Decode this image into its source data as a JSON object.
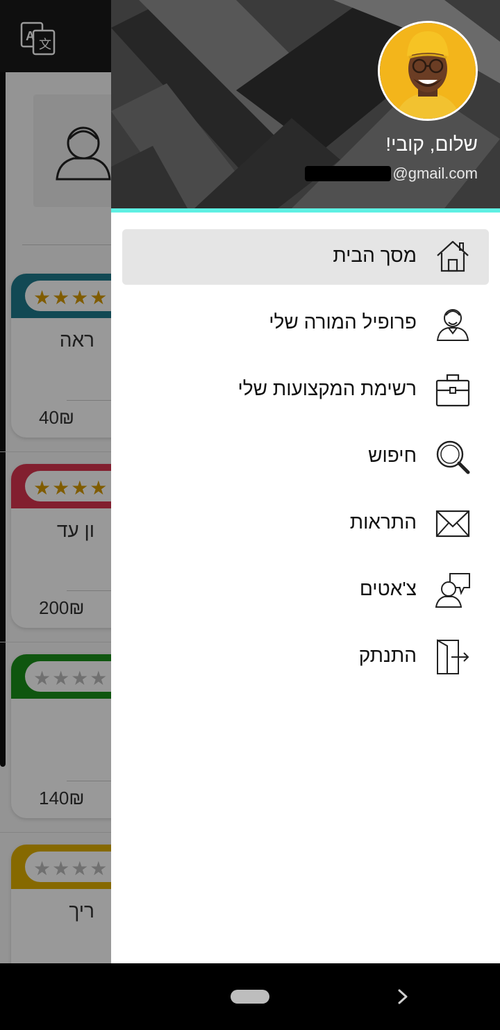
{
  "background": {
    "cards": [
      {
        "title": "ראה",
        "price": "40₪",
        "accent": "#1f7a8c",
        "stars_filled": 4
      },
      {
        "title": "ון עד",
        "price": "200₪",
        "accent": "#d9354f",
        "stars_filled": 4
      },
      {
        "title": "",
        "price": "140₪",
        "accent": "#1a8f1a",
        "stars_filled": 0
      },
      {
        "title": "ריך",
        "price": "",
        "accent": "#e0b000",
        "stars_filled": 0
      }
    ]
  },
  "drawer": {
    "greeting": "שלום, קובי!",
    "email_suffix": "@gmail.com",
    "accent_color": "#5ef0e3",
    "menu": [
      {
        "label": "מסך הבית",
        "icon": "home-icon",
        "active": true
      },
      {
        "label": "פרופיל המורה שלי",
        "icon": "teacher-profile-icon",
        "active": false
      },
      {
        "label": "רשימת המקצועות שלי",
        "icon": "briefcase-icon",
        "active": false
      },
      {
        "label": "חיפוש",
        "icon": "search-icon",
        "active": false
      },
      {
        "label": "התראות",
        "icon": "envelope-icon",
        "active": false
      },
      {
        "label": "צ'אטים",
        "icon": "chat-icon",
        "active": false
      },
      {
        "label": "התנתק",
        "icon": "logout-door-icon",
        "active": false
      }
    ]
  }
}
